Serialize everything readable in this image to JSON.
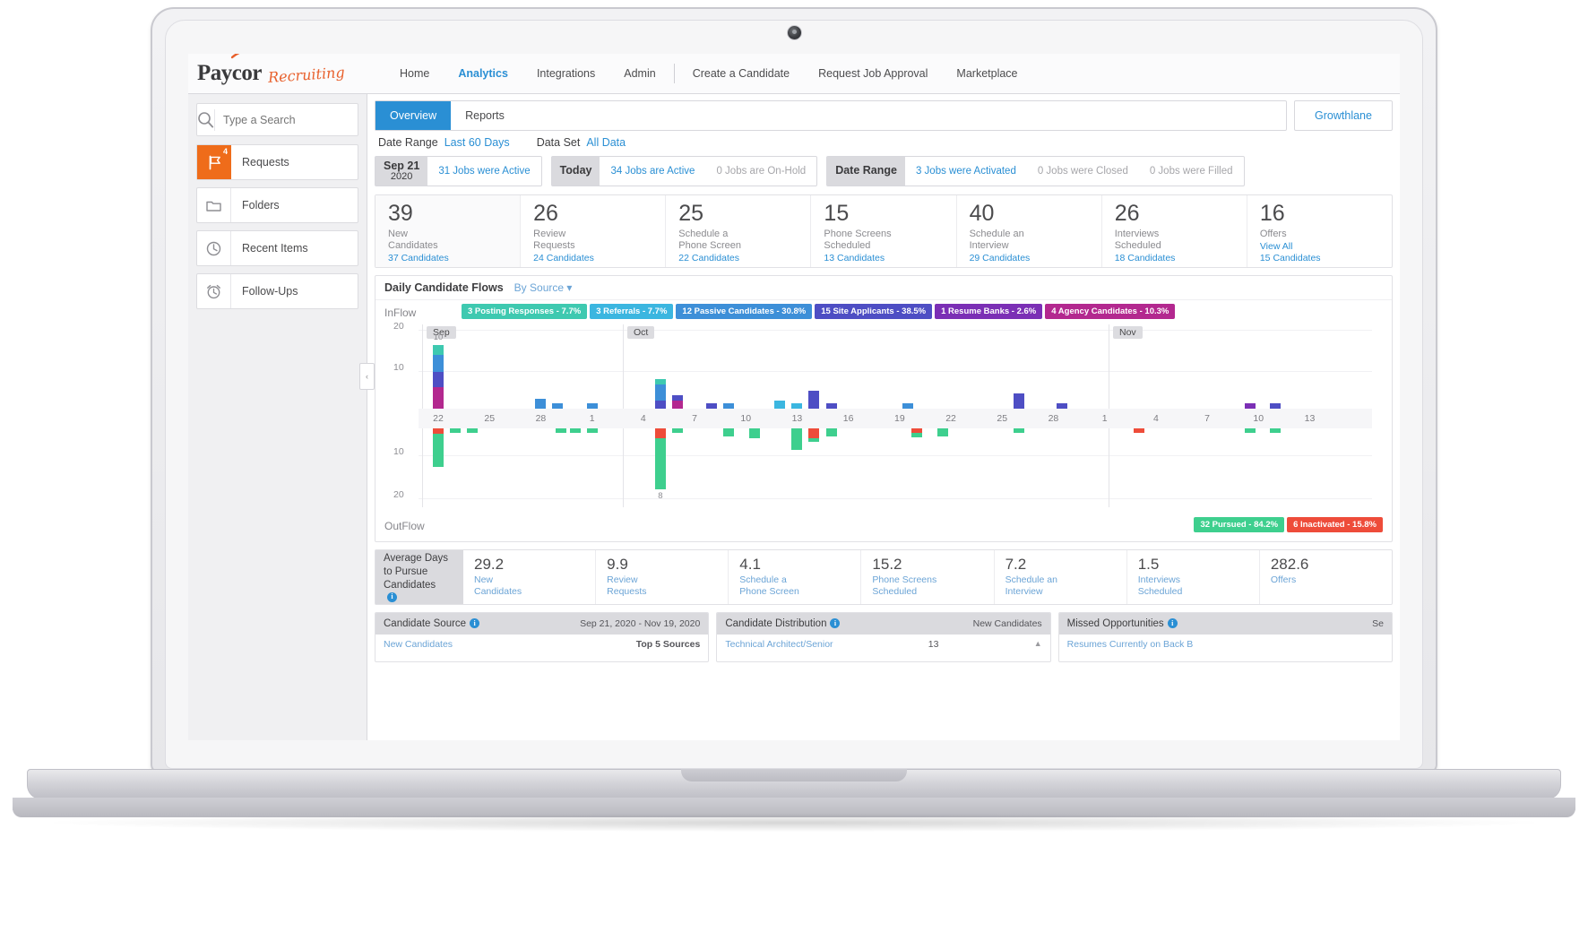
{
  "brand": {
    "name": "Paycor",
    "product": "Recruiting"
  },
  "nav": {
    "items": [
      {
        "label": "Home",
        "active": false
      },
      {
        "label": "Analytics",
        "active": true
      },
      {
        "label": "Integrations",
        "active": false
      },
      {
        "label": "Admin",
        "active": false
      },
      {
        "label": "Create a Candidate",
        "active": false
      },
      {
        "label": "Request Job Approval",
        "active": false
      },
      {
        "label": "Marketplace",
        "active": false
      }
    ]
  },
  "sidebar": {
    "search": {
      "placeholder": "Type a Search",
      "value": ""
    },
    "items": [
      {
        "label": "Requests",
        "icon": "flag-icon",
        "badge": "4",
        "accent": true
      },
      {
        "label": "Folders",
        "icon": "folder-icon",
        "badge": "",
        "accent": false
      },
      {
        "label": "Recent Items",
        "icon": "clock-icon",
        "badge": "",
        "accent": false
      },
      {
        "label": "Follow-Ups",
        "icon": "alarm-clock-icon",
        "badge": "",
        "accent": false
      }
    ],
    "collapse": "‹"
  },
  "tabs": [
    {
      "label": "Overview",
      "active": true
    },
    {
      "label": "Reports",
      "active": false
    }
  ],
  "growthlane": "Growthlane",
  "filters": {
    "date_range_label": "Date Range",
    "date_range_value": "Last 60 Days",
    "data_set_label": "Data Set",
    "data_set_value": "All Data"
  },
  "status_strip": [
    {
      "key": "Sep 21",
      "key_sub": "2020",
      "values": [
        {
          "text": "31 Jobs were Active",
          "muted": false
        }
      ]
    },
    {
      "key": "Today",
      "key_sub": "",
      "values": [
        {
          "text": "34 Jobs are Active",
          "muted": false
        },
        {
          "text": "0 Jobs are On-Hold",
          "muted": true
        }
      ]
    },
    {
      "key": "Date Range",
      "key_sub": "",
      "values": [
        {
          "text": "3 Jobs were Activated",
          "muted": false
        },
        {
          "text": "0 Jobs were Closed",
          "muted": true
        },
        {
          "text": "0 Jobs were Filled",
          "muted": true
        }
      ]
    }
  ],
  "kpis": [
    {
      "num": "39",
      "cap": "New\nCandidates",
      "link": "",
      "sub": "37 Candidates"
    },
    {
      "num": "26",
      "cap": "Review\nRequests",
      "link": "",
      "sub": "24 Candidates"
    },
    {
      "num": "25",
      "cap": "Schedule a\nPhone Screen",
      "link": "",
      "sub": "22 Candidates"
    },
    {
      "num": "15",
      "cap": "Phone Screens\nScheduled",
      "link": "",
      "sub": "13 Candidates"
    },
    {
      "num": "40",
      "cap": "Schedule an\nInterview",
      "link": "",
      "sub": "29 Candidates"
    },
    {
      "num": "26",
      "cap": "Interviews\nScheduled",
      "link": "",
      "sub": "18 Candidates"
    },
    {
      "num": "16",
      "cap": "Offers",
      "link": "View All",
      "sub": "15 Candidates"
    }
  ],
  "chart_panel": {
    "title": "Daily Candidate Flows",
    "group_by": "By Source ▾",
    "inflow_label": "InFlow",
    "outflow_label": "OutFlow"
  },
  "chart_data": {
    "type": "bar",
    "title": "Daily Candidate Flows",
    "subtitle": "By Source",
    "stacked": true,
    "orientation": "vertical-diverging",
    "xlabel": "",
    "ylabel": "",
    "ylim": [
      -20,
      20
    ],
    "yticks_top": [
      "20",
      "10"
    ],
    "yticks_bottom": [
      "10",
      "20"
    ],
    "grid": true,
    "month_markers": [
      "Sep",
      "Oct",
      "Nov"
    ],
    "x_tick_labels": [
      "22",
      "25",
      "28",
      "1",
      "4",
      "7",
      "10",
      "13",
      "16",
      "19",
      "22",
      "25",
      "28",
      "1",
      "4",
      "7",
      "10",
      "13"
    ],
    "inflow_legend": [
      {
        "label": "3 Posting Responses - 7.7%",
        "count": 3,
        "pct": 7.7,
        "color": "#3ec9b0"
      },
      {
        "label": "3 Referrals - 7.7%",
        "count": 3,
        "pct": 7.7,
        "color": "#3bb6e0"
      },
      {
        "label": "12 Passive Candidates - 30.8%",
        "count": 12,
        "pct": 30.8,
        "color": "#3d8fd8"
      },
      {
        "label": "15 Site Applicants - 38.5%",
        "count": 15,
        "pct": 38.5,
        "color": "#4e4ec4"
      },
      {
        "label": "1 Resume Banks - 2.6%",
        "count": 1,
        "pct": 2.6,
        "color": "#7b2fb5"
      },
      {
        "label": "4 Agency Candidates - 10.3%",
        "count": 4,
        "pct": 10.3,
        "color": "#b3288f"
      }
    ],
    "outflow_legend": [
      {
        "label": "32 Pursued - 84.2%",
        "count": 32,
        "pct": 84.2,
        "color": "#3ecf8e"
      },
      {
        "label": "6 Inactivated - 15.8%",
        "count": 6,
        "pct": 15.8,
        "color": "#ee4c3a"
      }
    ],
    "peak_inflow_label": "10",
    "peak_outflow_label": "8",
    "inflow_series": [
      {
        "name": "Posting Responses",
        "color": "#3ec9b0"
      },
      {
        "name": "Referrals",
        "color": "#3bb6e0"
      },
      {
        "name": "Passive Candidates",
        "color": "#3d8fd8"
      },
      {
        "name": "Site Applicants",
        "color": "#4e4ec4"
      },
      {
        "name": "Resume Banks",
        "color": "#7b2fb5"
      },
      {
        "name": "Agency Candidates",
        "color": "#b3288f"
      }
    ],
    "bars": [
      {
        "x": 22,
        "month": "Sep",
        "inflow": {
          "Posting Responses": 1.6,
          "Passive Candidates": 2.6,
          "Site Applicants": 2.4,
          "Agency Candidates": 3.4
        },
        "inflow_total": 10,
        "outflow": {
          "Inactivated": 0.9,
          "Pursued": 5.1
        },
        "outflow_total": 6
      },
      {
        "x": 23,
        "outflow": {
          "Pursued": 0.7
        },
        "outflow_total": 1
      },
      {
        "x": 24,
        "outflow": {
          "Pursued": 0.7
        },
        "outflow_total": 1
      },
      {
        "x": 28,
        "inflow": {
          "Passive Candidates": 1.6
        },
        "inflow_total": 2
      },
      {
        "x": 29,
        "inflow": {
          "Passive Candidates": 0.9
        },
        "inflow_total": 1
      },
      {
        "x": 29.2,
        "outflow": {
          "Pursued": 0.7
        },
        "outflow_total": 1
      },
      {
        "x": 30,
        "outflow": {
          "Pursued": 0.7
        },
        "outflow_total": 1
      },
      {
        "x": 31,
        "inflow": {
          "Passive Candidates": 0.9
        },
        "inflow_total": 1,
        "outflow": {
          "Pursued": 0.7
        },
        "outflow_total": 1
      },
      {
        "x": 5,
        "month": "Oct",
        "inflow": {
          "Posting Responses": 0.9,
          "Passive Candidates": 2.6,
          "Site Applicants": 1.2
        },
        "inflow_total": 5,
        "outflow": {
          "Inactivated": 1.6,
          "Pursued": 3.4
        },
        "outflow_total": 5
      },
      {
        "x": 6,
        "inflow": {
          "Site Applicants": 0.9,
          "Agency Candidates": 1.2
        },
        "inflow_total": 2,
        "outflow": {
          "Pursued": 0.7
        },
        "outflow_total": 1
      },
      {
        "x": 8,
        "inflow": {
          "Site Applicants": 0.9
        },
        "inflow_total": 1
      },
      {
        "x": 9,
        "inflow": {
          "Passive Candidates": 0.9
        },
        "inflow_total": 1,
        "outflow": {
          "Pursued": 1.3
        },
        "outflow_total": 2
      },
      {
        "x": 10.5,
        "outflow": {
          "Pursued": 1.6
        },
        "outflow_total": 2
      },
      {
        "x": 12,
        "inflow": {
          "Referrals": 1.3
        },
        "inflow_total": 2
      },
      {
        "x": 13,
        "inflow": {
          "Referrals": 0.9
        },
        "inflow_total": 1,
        "outflow": {
          "Pursued": 3.4
        },
        "outflow_total": 4
      },
      {
        "x": 14,
        "inflow": {
          "Site Applicants": 2.8
        },
        "inflow_total": 3,
        "outflow": {
          "Inactivated": 1.6,
          "Pursued": 0.5
        },
        "outflow_total": 2
      },
      {
        "x": 15,
        "inflow": {
          "Site Applicants": 0.9
        },
        "inflow_total": 1,
        "outflow": {
          "Pursued": 1.3
        },
        "outflow_total": 2
      },
      {
        "x": 19.5,
        "inflow": {
          "Passive Candidates": 0.9
        },
        "inflow_total": 1
      },
      {
        "x": 20,
        "outflow": {
          "Inactivated": 0.7,
          "Pursued": 0.7
        },
        "outflow_total": 2
      },
      {
        "x": 21.5,
        "outflow": {
          "Pursued": 1.3
        },
        "outflow_total": 2
      },
      {
        "x": 26,
        "inflow": {
          "Site Applicants": 2.4
        },
        "inflow_total": 3,
        "outflow": {
          "Pursued": 0.7
        },
        "outflow_total": 1
      },
      {
        "x": 28.5,
        "inflow": {
          "Site Applicants": 0.9
        },
        "inflow_total": 1
      },
      {
        "x": 3,
        "month": "Nov",
        "outflow": {
          "Inactivated": 0.7
        },
        "outflow_total": 1
      },
      {
        "x": 9.5,
        "inflow": {
          "Resume Banks": 0.9
        },
        "inflow_total": 1,
        "outflow": {
          "Pursued": 0.7
        },
        "outflow_total": 1
      },
      {
        "x": 11,
        "inflow": {
          "Site Applicants": 0.9
        },
        "inflow_total": 1,
        "outflow": {
          "Pursued": 0.7
        },
        "outflow_total": 1
      }
    ]
  },
  "avg_days": {
    "key": "Average Days\nto Pursue\nCandidates",
    "cells": [
      {
        "n": "29.2",
        "c": "New\nCandidates"
      },
      {
        "n": "9.9",
        "c": "Review\nRequests"
      },
      {
        "n": "4.1",
        "c": "Schedule a\nPhone Screen"
      },
      {
        "n": "15.2",
        "c": "Phone Screens\nScheduled"
      },
      {
        "n": "7.2",
        "c": "Schedule an\nInterview"
      },
      {
        "n": "1.5",
        "c": "Interviews\nScheduled"
      },
      {
        "n": "282.6",
        "c": "Offers"
      }
    ]
  },
  "bottom_panels": [
    {
      "title": "Candidate Source",
      "right": "Sep 21, 2020 - Nov 19, 2020",
      "body_left": "New Candidates",
      "body_right": "Top 5 Sources"
    },
    {
      "title": "Candidate Distribution",
      "right": "New Candidates",
      "body_left": "Technical Architect/Senior",
      "body_right": "13"
    },
    {
      "title": "Missed Opportunities",
      "right": "Se",
      "body_left": "Resumes Currently on Back B",
      "body_right": ""
    }
  ]
}
